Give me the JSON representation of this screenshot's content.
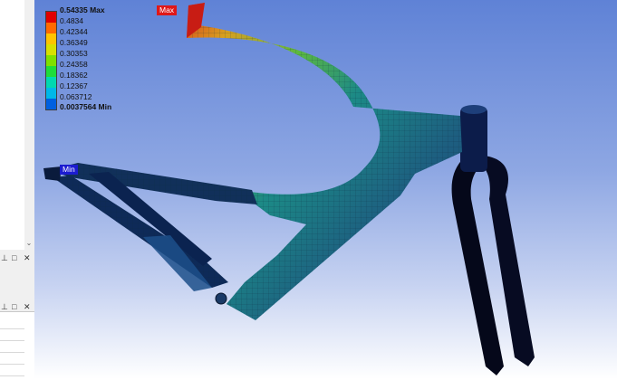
{
  "legend": {
    "entries": [
      {
        "label": "0.54335 Max",
        "color": "#e00000",
        "bold": true
      },
      {
        "label": "0.4834",
        "color": "#ff6a00",
        "bold": false
      },
      {
        "label": "0.42344",
        "color": "#ffc400",
        "bold": false
      },
      {
        "label": "0.36349",
        "color": "#d8e000",
        "bold": false
      },
      {
        "label": "0.30353",
        "color": "#7fe000",
        "bold": false
      },
      {
        "label": "0.24358",
        "color": "#1fdc3a",
        "bold": false
      },
      {
        "label": "0.18362",
        "color": "#00d8b0",
        "bold": false
      },
      {
        "label": "0.12367",
        "color": "#00b8e8",
        "bold": false
      },
      {
        "label": "0.063712",
        "color": "#0060e0",
        "bold": false
      },
      {
        "label": "0.0037564 Min",
        "color": "#0000c8",
        "bold": true
      }
    ]
  },
  "markers": {
    "max_label": "Max",
    "min_label": "Min",
    "max_color": "#e01818",
    "min_color": "#1c1cd0"
  },
  "left_panel": {
    "scroll_down_glyph": "⌄",
    "pane_icons": [
      "⊥",
      "□",
      "✕"
    ]
  }
}
